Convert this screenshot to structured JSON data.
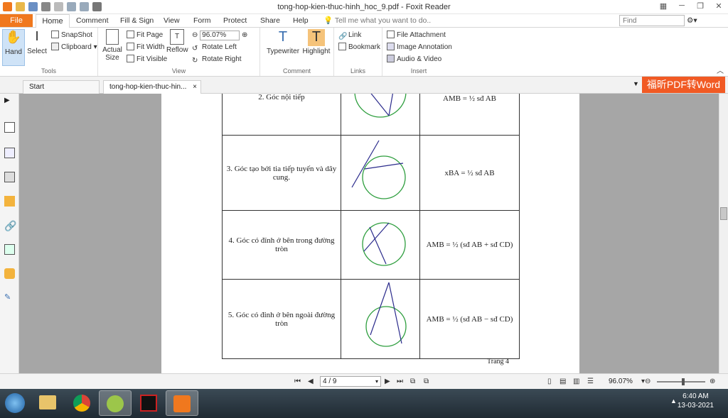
{
  "window": {
    "title": "tong-hop-kien-thuc-hinh_hoc_9.pdf - Foxit Reader"
  },
  "menu": {
    "file": "File",
    "tabs": [
      "Home",
      "Comment",
      "Fill & Sign",
      "View",
      "Form",
      "Protect",
      "Share",
      "Help"
    ],
    "tell_me": "Tell me what you want to do..",
    "find_placeholder": "Find"
  },
  "ribbon": {
    "tools": {
      "hand": "Hand",
      "select": "Select",
      "snapshot": "SnapShot",
      "clipboard": "Clipboard",
      "label": "Tools"
    },
    "view": {
      "actual_size_1": "Actual",
      "actual_size_2": "Size",
      "fit_page": "Fit Page",
      "fit_width": "Fit Width",
      "fit_visible": "Fit Visible",
      "reflow": "Reflow",
      "zoom": "96.07%",
      "rotate_left": "Rotate Left",
      "rotate_right": "Rotate Right",
      "label": "View"
    },
    "comment": {
      "typewriter": "Typewriter",
      "highlight": "Highlight",
      "label": "Comment"
    },
    "links": {
      "link": "Link",
      "bookmark": "Bookmark",
      "label": "Links"
    },
    "insert": {
      "file_attachment": "File Attachment",
      "image_annotation": "Image Annotation",
      "audio_video": "Audio & Video",
      "label": "Insert"
    }
  },
  "doc_tabs": {
    "start": "Start",
    "current": "tong-hop-kien-thuc-hin...",
    "ad": "福昕PDF转Word"
  },
  "document": {
    "rows": [
      {
        "name": "2. Góc nội tiếp",
        "formula": "AMB = ½ sđ AB"
      },
      {
        "name": "3. Góc tạo bởi tia tiếp tuyến và dây cung.",
        "formula": "xBA = ½ sđ AB"
      },
      {
        "name": "4. Góc có đỉnh ở bên trong đường tròn",
        "formula": "AMB = ½ (sđ AB + sđ CD)"
      },
      {
        "name": "5. Góc có đỉnh ở bên ngoài đường tròn",
        "formula": "AMB = ½ (sđ AB − sđ CD)"
      }
    ],
    "page_label": "Trang 4"
  },
  "status": {
    "page": "4 / 9",
    "zoom": "96.07%",
    "zoom_fraction": 0.55
  },
  "taskbar": {
    "time": "6:40 AM",
    "date": "13-03-2021"
  },
  "colors": {
    "accent": "#f0781e",
    "ad": "#f15a24",
    "circle": "#2e9e3e",
    "lines": "#2b2b8c"
  }
}
